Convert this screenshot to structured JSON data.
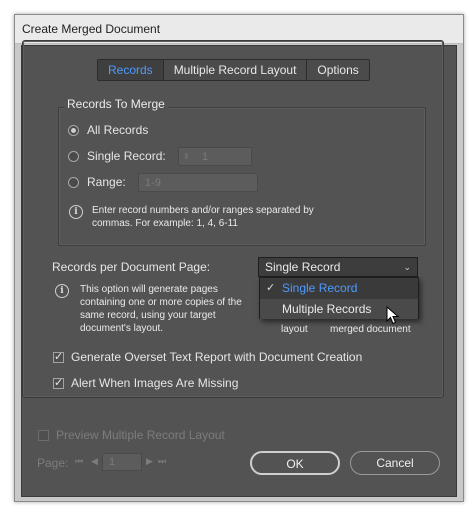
{
  "window": {
    "title": "Create Merged Document"
  },
  "tabs": [
    {
      "label": "Records",
      "active": true
    },
    {
      "label": "Multiple Record Layout",
      "active": false
    },
    {
      "label": "Options",
      "active": false
    }
  ],
  "records_group": {
    "label": "Records To Merge",
    "all_records": "All Records",
    "single_record": "Single Record:",
    "single_record_value": "1",
    "range": "Range:",
    "range_value": "1-9",
    "info_line1": "Enter record numbers and/or ranges separated by",
    "info_line2": "commas. For example: 1, 4, 6-11"
  },
  "per_page": {
    "label": "Records per Document Page:",
    "selected": "Single Record",
    "options": [
      "Single Record",
      "Multiple Records"
    ],
    "info_line1": "This option will generate pages",
    "info_line2": "containing one or more copies of the",
    "info_line3": "same record, using your target",
    "info_line4": "document's layout.",
    "hidden_text_1": "layout",
    "hidden_text_2": "merged document"
  },
  "options": {
    "overset_report": "Generate Overset Text Report with Document Creation",
    "alert_images": "Alert When Images Are Missing"
  },
  "footer": {
    "preview": "Preview Multiple Record Layout",
    "page_label": "Page:",
    "page_value": "1",
    "ok": "OK",
    "cancel": "Cancel"
  },
  "colors": {
    "accent": "#4d9bff",
    "panel": "#535353"
  }
}
